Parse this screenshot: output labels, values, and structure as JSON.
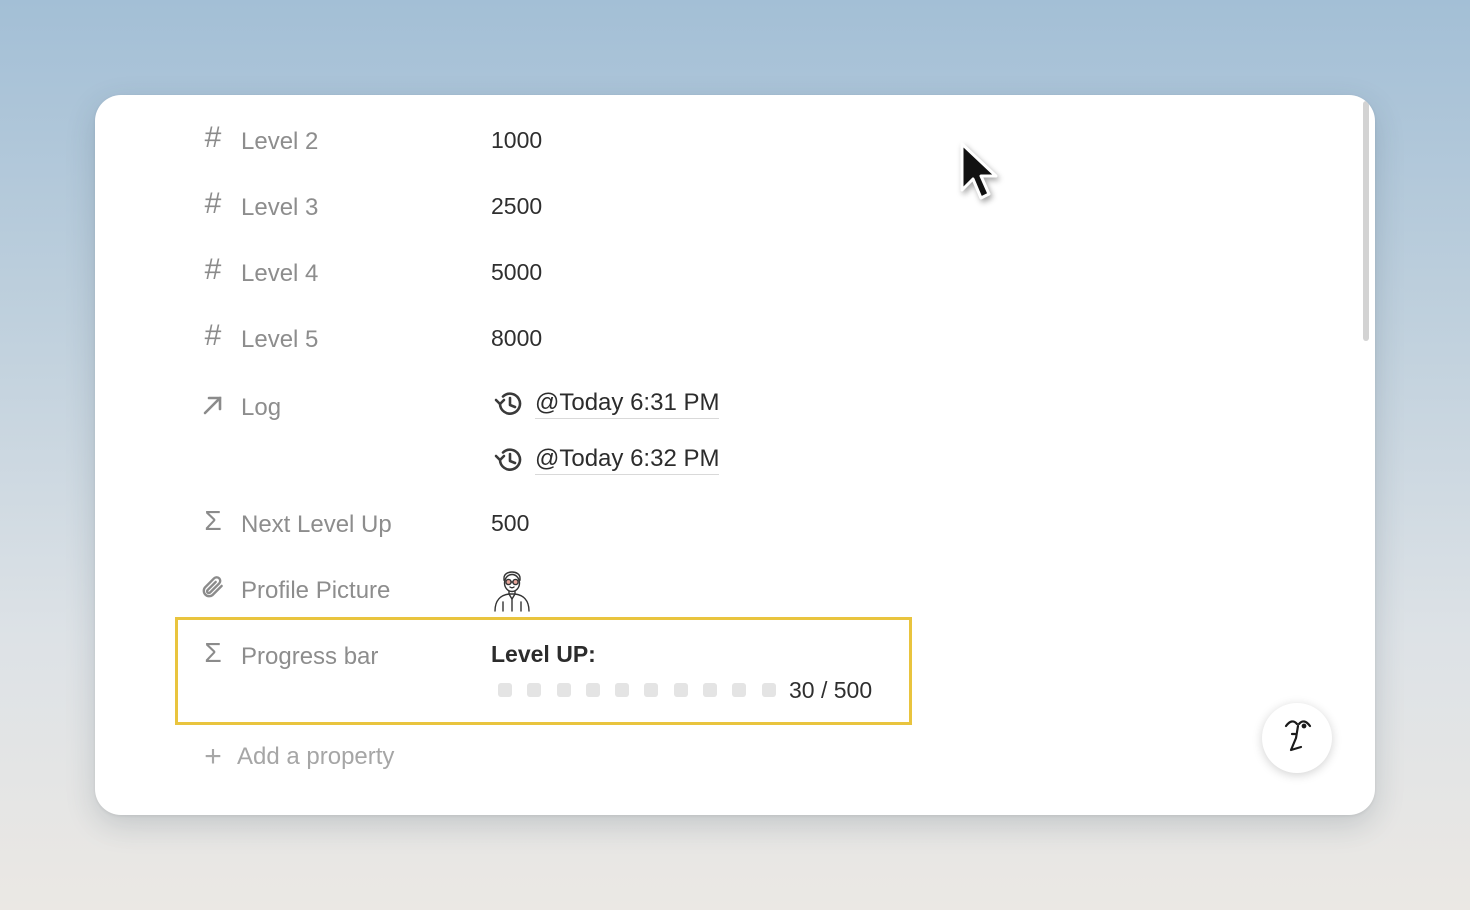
{
  "properties": [
    {
      "icon": "hash-icon",
      "label": "Level 2",
      "value": "1000"
    },
    {
      "icon": "hash-icon",
      "label": "Level 3",
      "value": "2500"
    },
    {
      "icon": "hash-icon",
      "label": "Level 4",
      "value": "5000"
    },
    {
      "icon": "hash-icon",
      "label": "Level 5",
      "value": "8000"
    }
  ],
  "log": {
    "icon": "relation-arrow-icon",
    "label": "Log",
    "entries": [
      {
        "icon": "history-icon",
        "text": "@Today 6:31 PM"
      },
      {
        "icon": "history-icon",
        "text": "@Today 6:32 PM"
      }
    ]
  },
  "next_level_up": {
    "icon": "sigma-icon",
    "label": "Next Level Up",
    "value": "500"
  },
  "profile_picture": {
    "icon": "paperclip-icon",
    "label": "Profile Picture"
  },
  "progress_bar": {
    "icon": "sigma-icon",
    "label": "Progress bar",
    "title": "Level UP:",
    "boxes_total": 10,
    "boxes_filled": 0,
    "count_text": "30 / 500",
    "highlight_color": "#e9c43e"
  },
  "add_property": {
    "label": "Add a property",
    "icon": "plus-icon"
  },
  "ai_button": {
    "icon": "notion-ai-face-icon"
  }
}
